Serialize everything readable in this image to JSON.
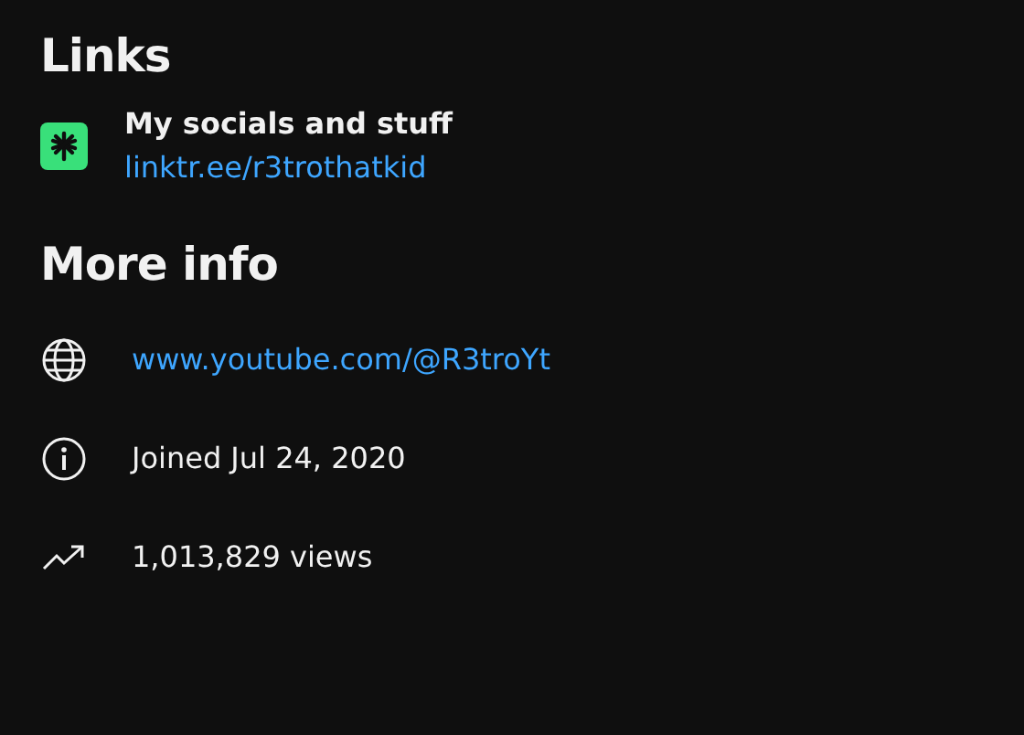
{
  "links": {
    "heading": "Links",
    "items": [
      {
        "title": "My socials and stuff",
        "url": "linktr.ee/r3trothatkid"
      }
    ]
  },
  "more_info": {
    "heading": "More info",
    "rows": [
      {
        "kind": "link",
        "text": "www.youtube.com/@R3troYt"
      },
      {
        "kind": "joined",
        "text": "Joined Jul 24, 2020"
      },
      {
        "kind": "views",
        "text": "1,013,829 views"
      }
    ]
  }
}
